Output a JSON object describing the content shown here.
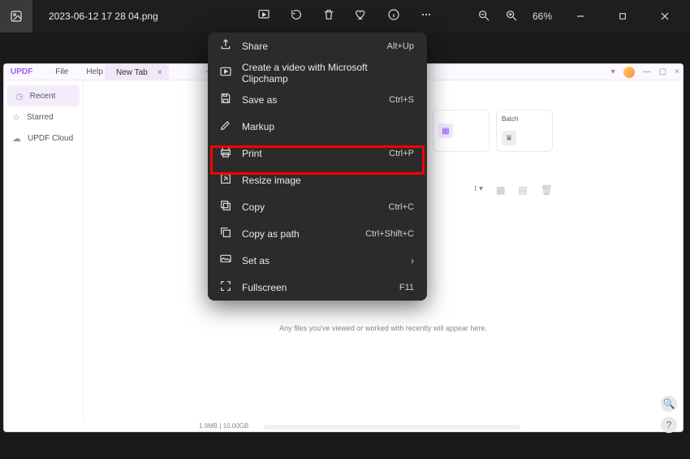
{
  "top_bar": {
    "file_name": "2023-06-12 17 28 04.png",
    "zoom": "66%"
  },
  "context_menu": {
    "items": [
      {
        "label": "Share",
        "shortcut": "Alt+Up",
        "icon": "share-icon"
      },
      {
        "label": "Create a video with Microsoft Clipchamp",
        "shortcut": "",
        "icon": "clipchamp-icon"
      },
      {
        "label": "Save as",
        "shortcut": "Ctrl+S",
        "icon": "save-icon"
      },
      {
        "label": "Markup",
        "shortcut": "",
        "icon": "markup-icon"
      },
      {
        "label": "Print",
        "shortcut": "Ctrl+P",
        "icon": "print-icon"
      },
      {
        "label": "Resize image",
        "shortcut": "",
        "icon": "resize-icon"
      },
      {
        "label": "Copy",
        "shortcut": "Ctrl+C",
        "icon": "copy-icon"
      },
      {
        "label": "Copy as path",
        "shortcut": "Ctrl+Shift+C",
        "icon": "path-icon"
      },
      {
        "label": "Set as",
        "shortcut": "",
        "icon": "setas-icon",
        "submenu": true
      },
      {
        "label": "Fullscreen",
        "shortcut": "F11",
        "icon": "fullscreen-icon"
      }
    ]
  },
  "updf": {
    "logo": "UPDF",
    "menu_file": "File",
    "menu_help": "Help",
    "tab_label": "New Tab",
    "sidebar": {
      "recent": "Recent",
      "starred": "Starred",
      "cloud": "UPDF Cloud"
    },
    "cards": {
      "batch": "Batch"
    },
    "sort_label": "t",
    "empty_msg": "Any files you've viewed or worked with recently will appear here.",
    "status": "1.9MB | 10.00GB"
  }
}
